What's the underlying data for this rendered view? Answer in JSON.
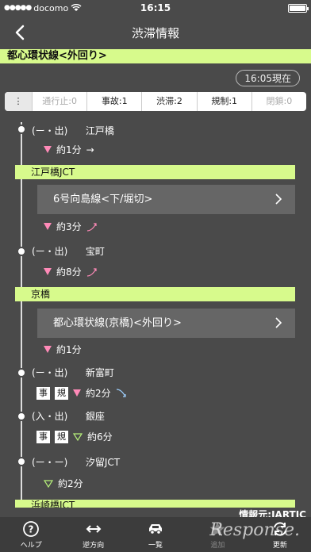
{
  "status": {
    "carrier": "docomo",
    "time": "16:15"
  },
  "nav": {
    "title": "渋滞情報"
  },
  "route": "都心環状線<外回り>",
  "as_of": "16:05現在",
  "tabs": [
    {
      "label": "⋮"
    },
    {
      "label": "通行止:0"
    },
    {
      "label": "事故:1"
    },
    {
      "label": "渋滞:2"
    },
    {
      "label": "規制:1"
    },
    {
      "label": "閉鎖:0"
    }
  ],
  "entries": {
    "edobashi": {
      "kind": "(ー・出)",
      "name": "江戸橋",
      "duration": "約1分",
      "trend": "→"
    },
    "edobashi_jct": {
      "label": "江戸橋JCT",
      "link": "6号向島線<下/堀切>",
      "duration": "約3分"
    },
    "takaracho": {
      "kind": "(ー・出)",
      "name": "宝町",
      "duration": "約8分"
    },
    "kyobashi": {
      "label": "京橋",
      "link": "都心環状線(京橋)<外回り>",
      "duration": "約1分"
    },
    "shintomicho": {
      "kind": "(ー・出)",
      "name": "新富町",
      "badge1": "事",
      "badge2": "規",
      "duration": "約2分"
    },
    "ginza": {
      "kind": "(入・出)",
      "name": "銀座",
      "badge1": "事",
      "badge2": "規",
      "duration": "約6分"
    },
    "shiodome": {
      "kind": "(ー・ー)",
      "name": "汐留JCT",
      "duration": "約2分"
    },
    "hamazakibashi": {
      "label": "浜崎橋JCT"
    }
  },
  "source": "情報元:JARTIC",
  "toolbar": [
    {
      "label": "ヘルプ",
      "icon": "help-icon"
    },
    {
      "label": "逆方向",
      "icon": "reverse-icon"
    },
    {
      "label": "一覧",
      "icon": "car-icon"
    },
    {
      "label": "追加",
      "icon": "star-icon"
    },
    {
      "label": "更新",
      "icon": "refresh-icon"
    }
  ],
  "watermark": "Response."
}
